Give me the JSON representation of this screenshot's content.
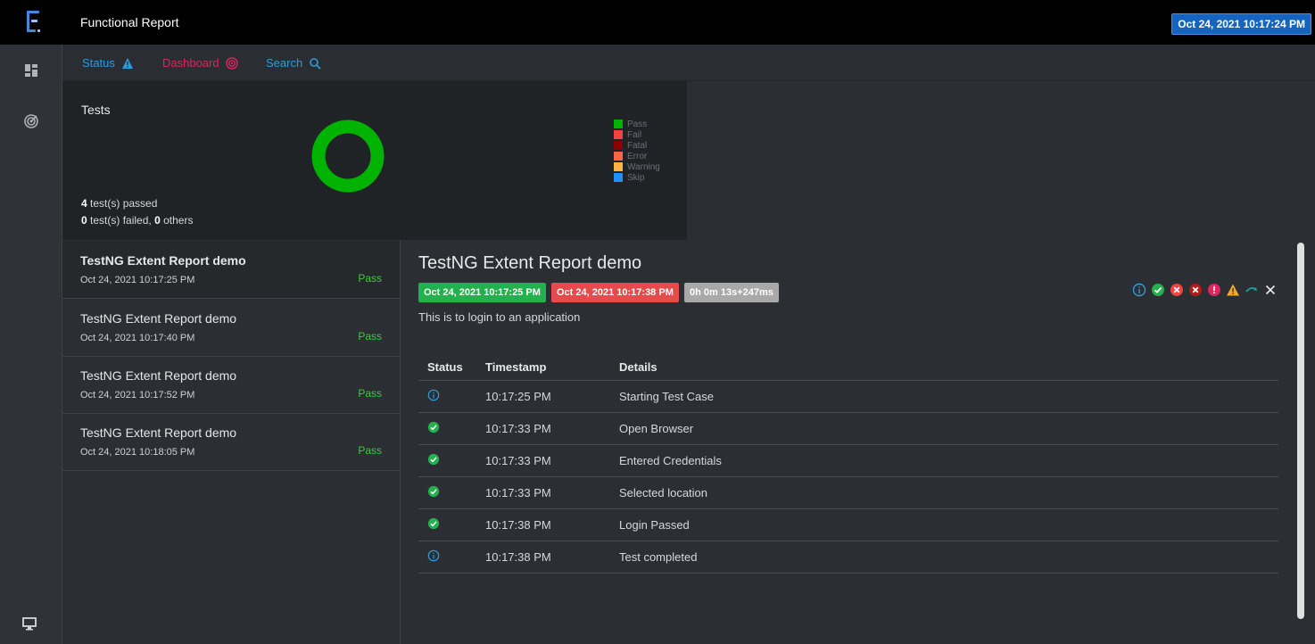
{
  "header": {
    "app_title": "Functional Report",
    "date": "Oct 24, 2021 10:17:24 PM"
  },
  "nav": {
    "tabs": [
      {
        "label": "Status",
        "color": "#2d9cdb"
      },
      {
        "label": "Dashboard",
        "color": "#e0245e"
      },
      {
        "label": "Search",
        "color": "#2d9cdb"
      }
    ]
  },
  "tests_card": {
    "title": "Tests",
    "passed_count": "4",
    "passed_text": "test(s) passed",
    "failed_count": "0",
    "failed_text": "test(s) failed,",
    "others_count": "0",
    "others_text": "others",
    "legend": [
      {
        "label": "Pass",
        "color": "#00b300"
      },
      {
        "label": "Fail",
        "color": "#f14343"
      },
      {
        "label": "Fatal",
        "color": "#8b0000"
      },
      {
        "label": "Error",
        "color": "#ff6347"
      },
      {
        "label": "Warning",
        "color": "#ffb347"
      },
      {
        "label": "Skip",
        "color": "#1e90ff"
      }
    ]
  },
  "chart_data": {
    "type": "pie",
    "categories": [
      "Pass",
      "Fail",
      "Fatal",
      "Error",
      "Warning",
      "Skip"
    ],
    "values": [
      4,
      0,
      0,
      0,
      0,
      0
    ],
    "title": "Tests"
  },
  "test_list": [
    {
      "name": "TestNG Extent Report demo",
      "date": "Oct 24, 2021 10:17:25 PM",
      "status": "Pass"
    },
    {
      "name": "TestNG Extent Report demo",
      "date": "Oct 24, 2021 10:17:40 PM",
      "status": "Pass"
    },
    {
      "name": "TestNG Extent Report demo",
      "date": "Oct 24, 2021 10:17:52 PM",
      "status": "Pass"
    },
    {
      "name": "TestNG Extent Report demo",
      "date": "Oct 24, 2021 10:18:05 PM",
      "status": "Pass"
    }
  ],
  "detail": {
    "title": "TestNG Extent Report demo",
    "start_badge": "Oct 24, 2021 10:17:25 PM",
    "end_badge": "Oct 24, 2021 10:17:38 PM",
    "duration_badge": "0h 0m 13s+247ms",
    "description": "This is to login to an application",
    "columns": [
      "Status",
      "Timestamp",
      "Details"
    ],
    "rows": [
      {
        "status": "info",
        "timestamp": "10:17:25 PM",
        "details": "Starting Test Case"
      },
      {
        "status": "pass",
        "timestamp": "10:17:33 PM",
        "details": "Open Browser"
      },
      {
        "status": "pass",
        "timestamp": "10:17:33 PM",
        "details": "Entered Credentials"
      },
      {
        "status": "pass",
        "timestamp": "10:17:33 PM",
        "details": "Selected location"
      },
      {
        "status": "pass",
        "timestamp": "10:17:38 PM",
        "details": "Login Passed"
      },
      {
        "status": "info",
        "timestamp": "10:17:38 PM",
        "details": "Test completed"
      }
    ]
  },
  "icons": {
    "logo": "extent-logo-icon",
    "nav_dashboard": "grid-icon",
    "nav_radar": "radar-icon",
    "nav_bottom": "monitor-icon",
    "status_tab": "warning-icon",
    "dashboard_tab": "radar-icon",
    "search_tab": "search-icon"
  }
}
